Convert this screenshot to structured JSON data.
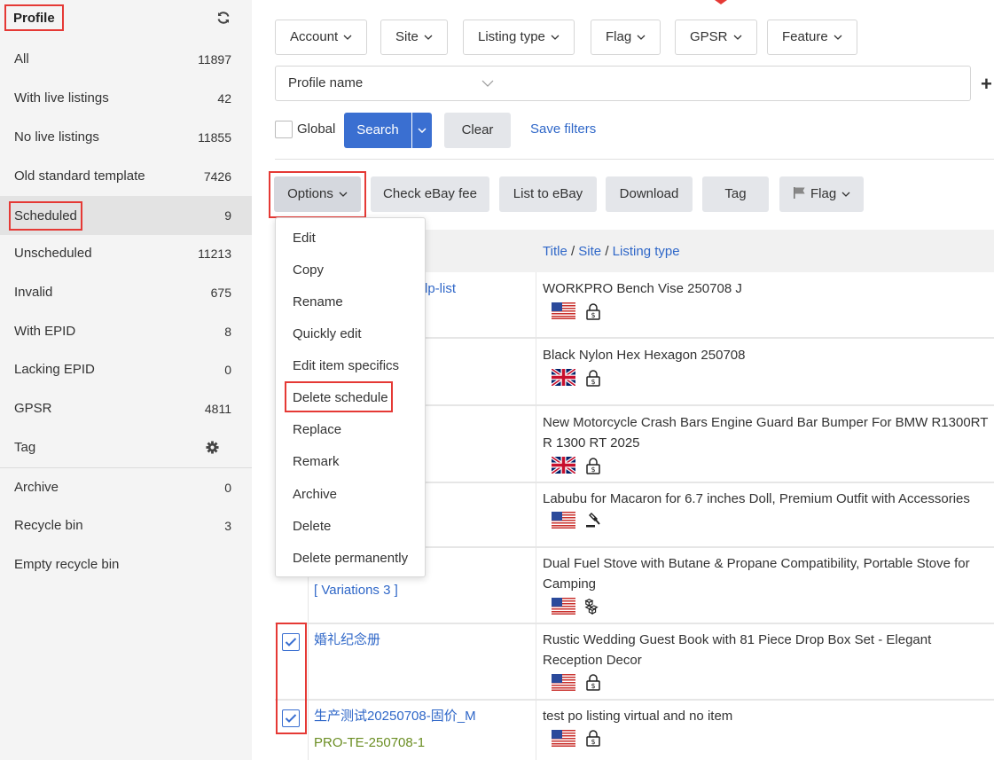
{
  "sidebar": {
    "title": "Profile",
    "items": [
      {
        "label": "All",
        "count": "11897"
      },
      {
        "label": "With live listings",
        "count": "42"
      },
      {
        "label": "No live listings",
        "count": "11855"
      },
      {
        "label": "Old standard template",
        "count": "7426"
      },
      {
        "label": "Scheduled",
        "count": "9"
      },
      {
        "label": "Unscheduled",
        "count": "11213"
      },
      {
        "label": "Invalid",
        "count": "675"
      },
      {
        "label": "With EPID",
        "count": "8"
      },
      {
        "label": "Lacking EPID",
        "count": "0"
      },
      {
        "label": "GPSR",
        "count": "4811"
      },
      {
        "label": "Tag",
        "count": ""
      },
      {
        "label": "Archive",
        "count": "0"
      },
      {
        "label": "Recycle bin",
        "count": "3"
      },
      {
        "label": "Empty recycle bin",
        "count": ""
      }
    ]
  },
  "filters": {
    "dropdowns": [
      "Account",
      "Site",
      "Listing type",
      "Flag",
      "GPSR",
      "Feature"
    ],
    "profile_name_label": "Profile name",
    "search_value": "",
    "global_label": "Global",
    "search_label": "Search",
    "clear_label": "Clear",
    "save_filters_label": "Save filters"
  },
  "actions": {
    "options": "Options",
    "check_fee": "Check eBay fee",
    "list_to_ebay": "List to eBay",
    "download": "Download",
    "tag": "Tag",
    "flag": "Flag"
  },
  "options_menu": [
    "Edit",
    "Copy",
    "Rename",
    "Quickly edit",
    "Edit item specifics",
    "Delete schedule",
    "Replace",
    "Remark",
    "Archive",
    "Delete",
    "Delete permanently"
  ],
  "table": {
    "header_title": "Title",
    "header_site": "Site",
    "header_listing_type": "Listing type",
    "rows": [
      {
        "name": "lp-list",
        "title": "WORKPRO Bench Vise 250708 J"
      },
      {
        "name": "",
        "title": "Black Nylon Hex Hexagon 250708"
      },
      {
        "name": "",
        "title": "New Motorcycle Crash Bars Engine Guard Bar Bumper For BMW R1300RT R 1300 RT 2025"
      },
      {
        "name": "",
        "title": "Labubu for Macaron for 6.7 inches Doll, Premium Outfit with Accessories"
      },
      {
        "name": "[ Variations 3 ]",
        "title": "Dual Fuel Stove with Butane & Propane Compatibility, Portable Stove for Camping"
      },
      {
        "name": "婚礼纪念册",
        "title": "Rustic Wedding Guest Book with 81 Piece Drop Box Set - Elegant Reception Decor"
      },
      {
        "name": "生产测试20250708-固价_M",
        "sku": "PRO-TE-250708-1",
        "title": "test po listing virtual and no item"
      }
    ]
  },
  "colors": {
    "accent": "#3a6fd1",
    "highlight": "#e53935",
    "link": "#2f67c8",
    "sku": "#6b8e23"
  }
}
